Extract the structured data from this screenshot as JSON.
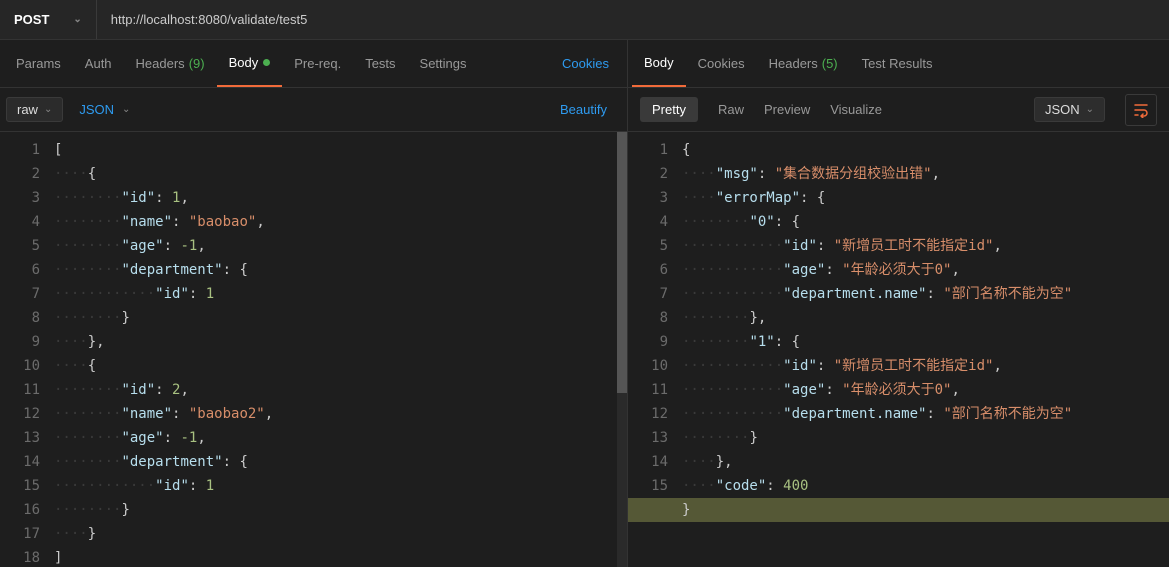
{
  "request": {
    "method": "POST",
    "url": "http://localhost:8080/validate/test5",
    "tabs": [
      {
        "label": "Params"
      },
      {
        "label": "Auth"
      },
      {
        "label": "Headers",
        "count": "(9)"
      },
      {
        "label": "Body",
        "active": true,
        "dot": true
      },
      {
        "label": "Pre-req."
      },
      {
        "label": "Tests"
      },
      {
        "label": "Settings"
      }
    ],
    "cookies_link": "Cookies",
    "body_type": "raw",
    "body_format": "JSON",
    "beautify": "Beautify",
    "body_raw": "[\n    {\n        \"id\": 1,\n        \"name\": \"baobao\",\n        \"age\": -1,\n        \"department\": {\n            \"id\": 1\n        }\n    },\n    {\n        \"id\": 2,\n        \"name\": \"baobao2\",\n        \"age\": -1,\n        \"department\": {\n            \"id\": 1\n        }\n    }\n]"
  },
  "response": {
    "tabs": [
      {
        "label": "Body",
        "active": true
      },
      {
        "label": "Cookies"
      },
      {
        "label": "Headers",
        "count": "(5)"
      },
      {
        "label": "Test Results"
      }
    ],
    "view_tabs": [
      {
        "label": "Pretty",
        "active": true
      },
      {
        "label": "Raw"
      },
      {
        "label": "Preview"
      },
      {
        "label": "Visualize"
      }
    ],
    "format": "JSON",
    "body": {
      "msg": "集合数据分组校验出错",
      "errorMap": {
        "0": {
          "id": "新增员工时不能指定id",
          "age": "年龄必须大于0",
          "department.name": "部门名称不能为空"
        },
        "1": {
          "id": "新增员工时不能指定id",
          "age": "年龄必须大于0",
          "department.name": "部门名称不能为空"
        }
      },
      "code": 400
    }
  }
}
